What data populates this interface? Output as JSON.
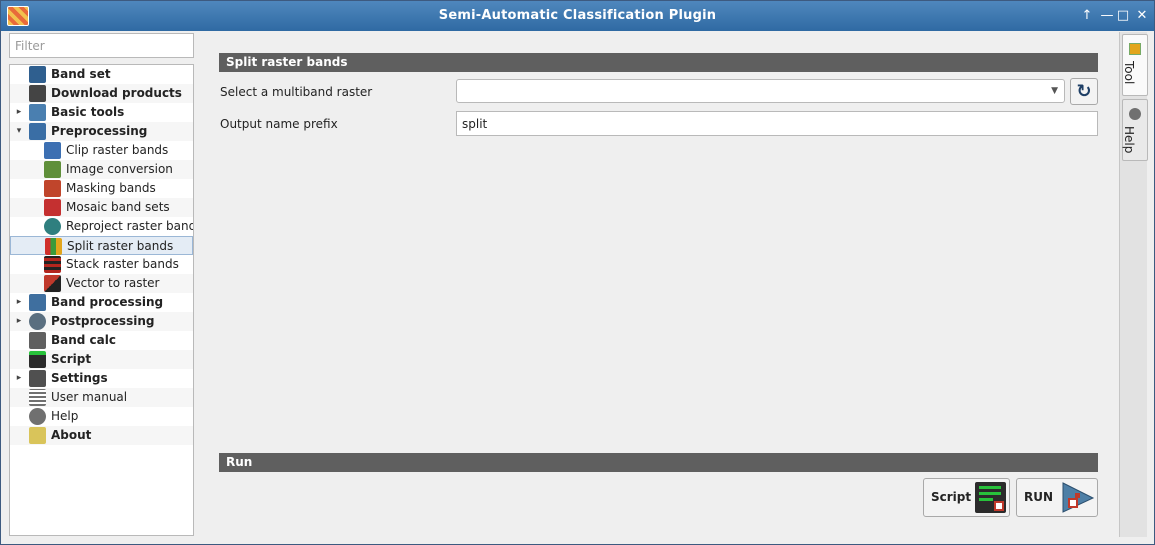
{
  "window": {
    "title": "Semi-Automatic Classification Plugin",
    "controls": [
      "↑",
      "—",
      "□",
      "✕"
    ]
  },
  "sidebar": {
    "filter_placeholder": "Filter",
    "items": [
      {
        "label": "Band set",
        "icon": "band-set-icon",
        "color": "#2f5f8f"
      },
      {
        "label": "Download products",
        "icon": "download-icon",
        "color": "#444444"
      },
      {
        "label": "Basic tools",
        "icon": "basic-tools-icon",
        "color": "#4a7fb0"
      },
      {
        "label": "Preprocessing",
        "icon": "preprocessing-icon",
        "color": "#3a6ea5"
      },
      {
        "label": "Clip raster bands",
        "icon": "clip-icon",
        "color": "#3c6fb2"
      },
      {
        "label": "Image conversion",
        "icon": "image-conversion-icon",
        "color": "#5f8f3a"
      },
      {
        "label": "Masking bands",
        "icon": "masking-icon",
        "color": "#c0452b"
      },
      {
        "label": "Mosaic band sets",
        "icon": "mosaic-icon",
        "color": "#c43030"
      },
      {
        "label": "Reproject raster bands",
        "icon": "reproject-icon",
        "color": "#2f7f7f"
      },
      {
        "label": "Split raster bands",
        "icon": "split-icon",
        "color": "#d0302b"
      },
      {
        "label": "Stack raster bands",
        "icon": "stack-icon",
        "color": "#b3261e"
      },
      {
        "label": "Vector to raster",
        "icon": "vector-to-raster-icon",
        "color": "#c0392b"
      },
      {
        "label": "Band processing",
        "icon": "band-processing-icon",
        "color": "#3f6f9f"
      },
      {
        "label": "Postprocessing",
        "icon": "postprocessing-icon",
        "color": "#5a6f80"
      },
      {
        "label": "Band calc",
        "icon": "band-calc-icon",
        "color": "#606060"
      },
      {
        "label": "Script",
        "icon": "script-icon",
        "color": "#2b2b2b"
      },
      {
        "label": "Settings",
        "icon": "settings-icon",
        "color": "#505050"
      },
      {
        "label": "User manual",
        "icon": "user-manual-icon",
        "color": "#707070"
      },
      {
        "label": "Help",
        "icon": "help-icon",
        "color": "#707070"
      },
      {
        "label": "About",
        "icon": "about-icon",
        "color": "#b8a43a"
      }
    ]
  },
  "main": {
    "section_title": "Split raster bands",
    "raster_label": "Select a multiband raster",
    "raster_value": "",
    "prefix_label": "Output name prefix",
    "prefix_value": "split",
    "refresh_symbol": "↻",
    "run_section_title": "Run",
    "script_button": "Script",
    "run_button": "RUN"
  },
  "dock": {
    "tabs": [
      {
        "label": "Tool",
        "icon": "tool-tab-icon"
      },
      {
        "label": "Help",
        "icon": "help-tab-icon"
      }
    ]
  }
}
